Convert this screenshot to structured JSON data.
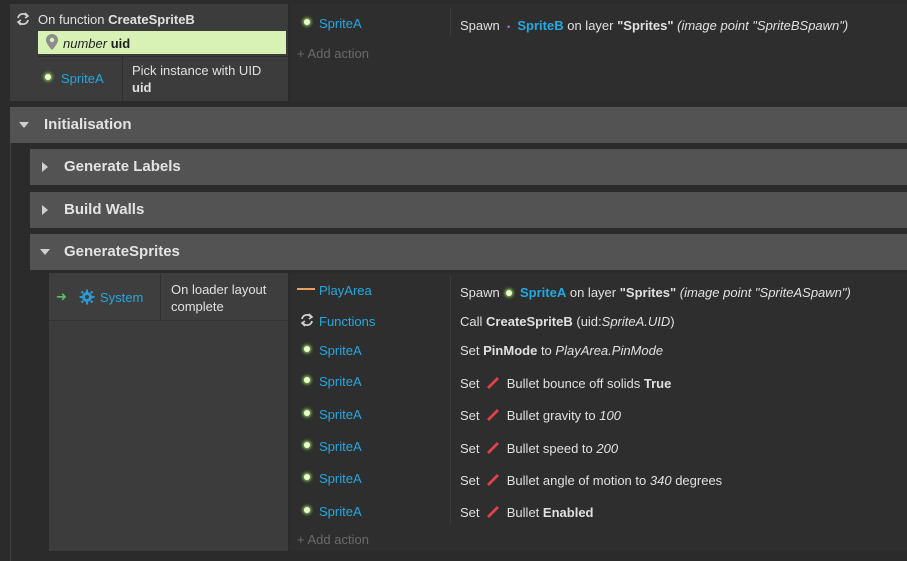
{
  "function_block": {
    "condition_prefix": "On function",
    "function_name": "CreateSpriteB",
    "param_type": "number",
    "param_name": "uid",
    "pick_object": "SpriteA",
    "pick_text": "Pick instance with UID",
    "pick_param": "uid",
    "action_object": "SpriteA",
    "action_verb": "Spawn",
    "action_target": "SpriteB",
    "action_on_layer": "on layer",
    "action_layer": "\"Sprites\"",
    "action_imagepoint": "(image point \"SpriteBSpawn\")",
    "add_action": "Add action"
  },
  "groups": {
    "initialisation": "Initialisation",
    "generate_labels": "Generate Labels",
    "build_walls": "Build Walls",
    "generate_sprites": "GenerateSprites"
  },
  "event": {
    "condition_object": "System",
    "condition_text_1": "On loader layout",
    "condition_text_2": "complete",
    "add_action": "Add action",
    "rows": [
      {
        "object": "PlayArea",
        "pre": "Spawn",
        "target": "SpriteA",
        "mid": "on layer",
        "bold2": "\"Sprites\"",
        "italic": "(image point \"SpriteASpawn\")"
      },
      {
        "object": "Functions",
        "pre": "Call",
        "bold": "CreateSpriteB",
        "rest": "(uid:",
        "italic": "SpriteA.UID",
        "post": ")"
      },
      {
        "object": "SpriteA",
        "pre": "Set",
        "bold": "PinMode",
        "rest": "to",
        "italic": "PlayArea.PinMode"
      },
      {
        "object": "SpriteA",
        "pre": "Set",
        "rest": "Bullet bounce off solids",
        "bold": "True"
      },
      {
        "object": "SpriteA",
        "pre": "Set",
        "rest": "Bullet gravity to",
        "italic": "100"
      },
      {
        "object": "SpriteA",
        "pre": "Set",
        "rest": "Bullet speed to",
        "italic": "200"
      },
      {
        "object": "SpriteA",
        "pre": "Set",
        "rest": "Bullet angle of motion to",
        "italic": "340",
        "post": "degrees"
      },
      {
        "object": "SpriteA",
        "pre": "Set",
        "rest": "Bullet",
        "bold": "Enabled"
      }
    ]
  },
  "colors": {
    "background": "#2b2b2b",
    "object_name": "#23a8e0",
    "group_bar": "#535353",
    "param_highlight": "#d8f2b5"
  }
}
